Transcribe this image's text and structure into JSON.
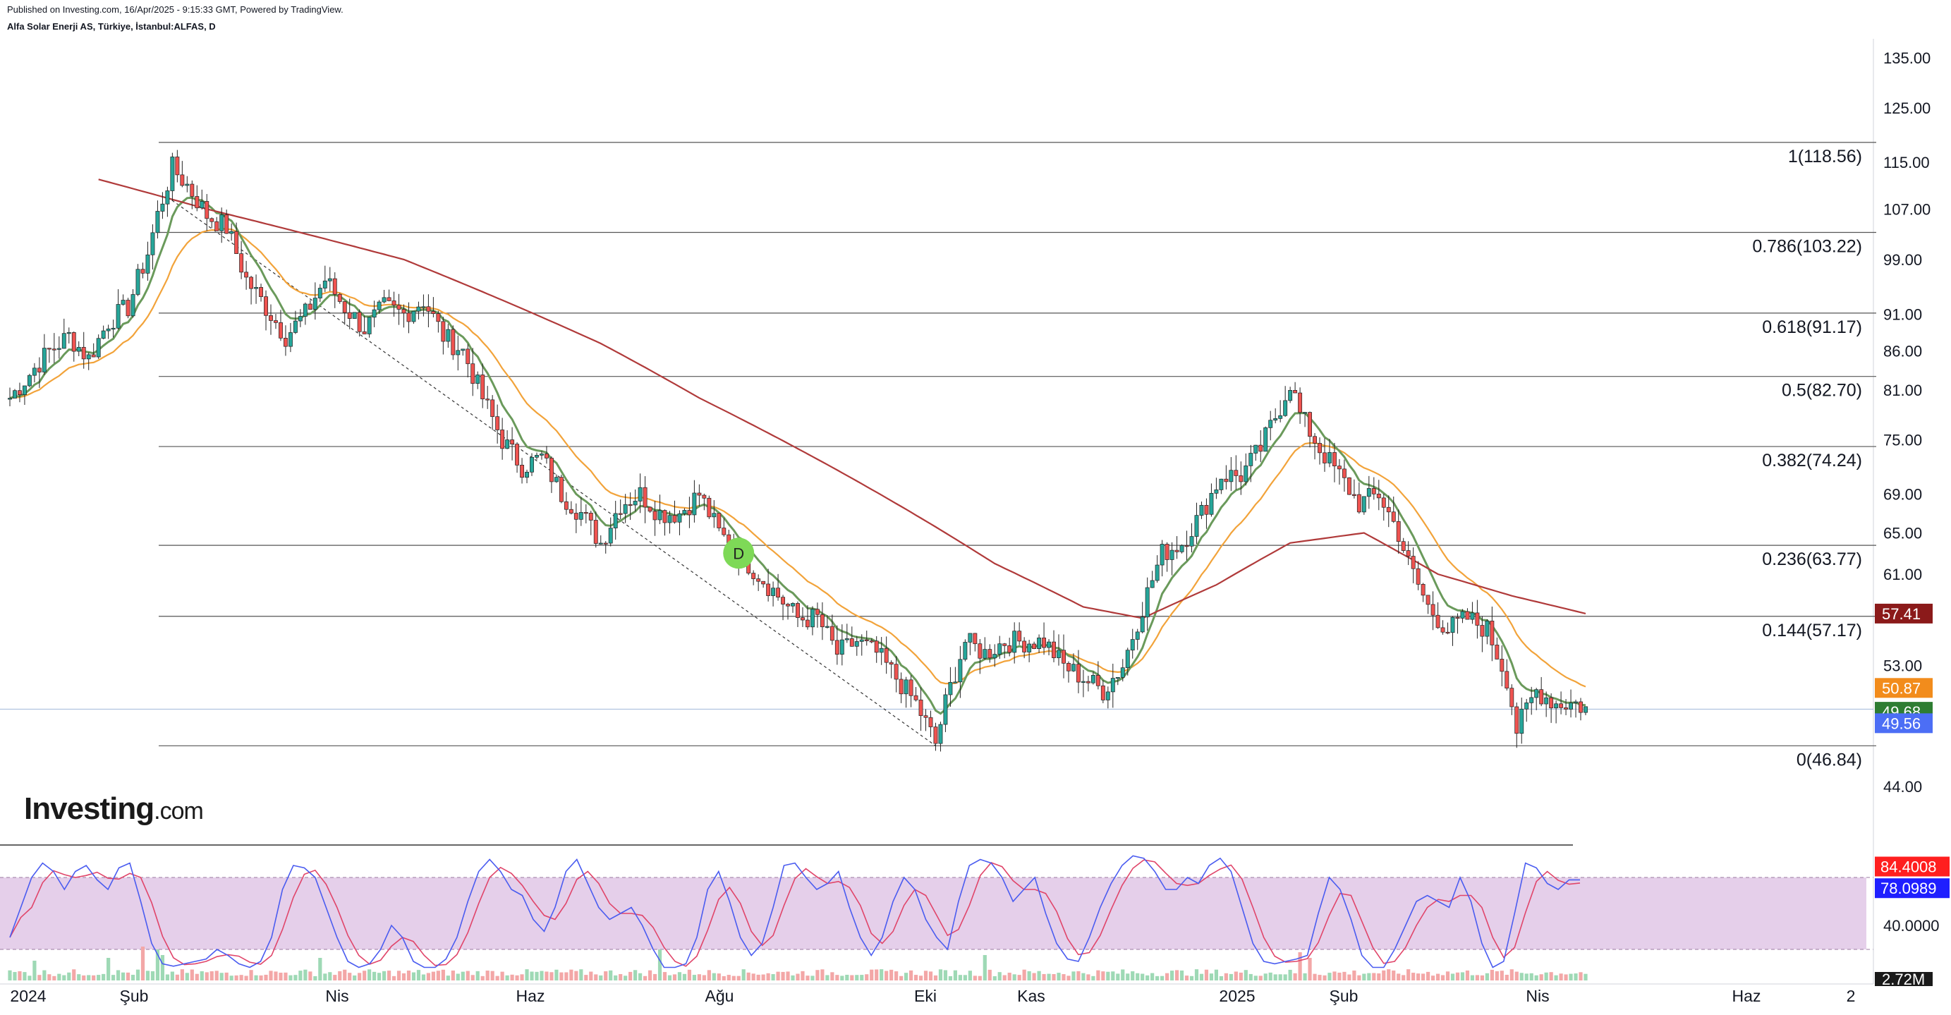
{
  "header": {
    "published": "Published on Investing.com, 16/Apr/2025 - 9:15:33 GMT, Powered by TradingView.",
    "symbol": "Alfa Solar Enerji AS, Türkiye, İstanbul:ALFAS, D"
  },
  "logo": {
    "brand": "Investing",
    "domain": ".com"
  },
  "colors": {
    "bull": "#26a69a",
    "bear": "#ef5350",
    "ema_fast": "#6a9a5b",
    "ema_mid": "#f2a33a",
    "ema_slow": "#b03a3a",
    "fib_line": "#555555",
    "stoch_k": "#4a5cf0",
    "stoch_d": "#e0456a",
    "stoch_band": "#e1c7e6"
  },
  "chart_data": [
    {
      "type": "candlestick",
      "title": "Alfa Solar Enerji AS, Türkiye, İstanbul:ALFAS, D",
      "x_ticks": [
        "2024",
        "Şub",
        "Nis",
        "Haz",
        "Ağu",
        "Eki",
        "Kas",
        "2025",
        "Şub",
        "Nis",
        "Haz",
        "2"
      ],
      "y_ticks": [
        135.0,
        125.0,
        115.0,
        107.0,
        99.0,
        91.0,
        86.0,
        81.0,
        75.0,
        69.0,
        65.0,
        61.0,
        53.0,
        44.0
      ],
      "y_tick_labels": [
        "135.00",
        "125.00",
        "115.00",
        "107.00",
        "99.00",
        "91.00",
        "86.00",
        "81.00",
        "75.00",
        "69.00",
        "65.00",
        "61.00",
        "53.00",
        "44.00"
      ],
      "ylim": [
        41,
        138
      ],
      "fib_levels": [
        {
          "label": "1(118.56)",
          "value": 118.56
        },
        {
          "label": "0.786(103.22)",
          "value": 103.22
        },
        {
          "label": "0.618(91.17)",
          "value": 91.17
        },
        {
          "label": "0.5(82.70)",
          "value": 82.7
        },
        {
          "label": "0.382(74.24)",
          "value": 74.24
        },
        {
          "label": "0.236(63.77)",
          "value": 63.77
        },
        {
          "label": "0.144(57.17)",
          "value": 57.17
        },
        {
          "label": "0(46.84)",
          "value": 46.84
        }
      ],
      "badges": [
        {
          "text": "57.41",
          "value": 57.41,
          "color": "#8b1a1a"
        },
        {
          "text": "50.87",
          "value": 50.87,
          "color": "#f28c1c"
        },
        {
          "text": "49.68",
          "value": 49.68,
          "color": "#2e7d32"
        },
        {
          "text": "49.56",
          "value": 49.56,
          "color": "#4c6ef5"
        }
      ],
      "marker": {
        "text": "D",
        "date_index": 148,
        "value": 63.0
      },
      "price_anchors": [
        [
          0,
          80
        ],
        [
          4,
          83
        ],
        [
          8,
          86
        ],
        [
          12,
          88
        ],
        [
          16,
          85
        ],
        [
          20,
          90
        ],
        [
          24,
          92
        ],
        [
          28,
          100
        ],
        [
          30,
          106
        ],
        [
          33,
          114
        ],
        [
          36,
          111
        ],
        [
          40,
          106
        ],
        [
          44,
          104
        ],
        [
          48,
          96
        ],
        [
          52,
          92
        ],
        [
          56,
          88
        ],
        [
          60,
          91
        ],
        [
          64,
          96
        ],
        [
          68,
          92
        ],
        [
          72,
          89
        ],
        [
          76,
          92
        ],
        [
          80,
          91
        ],
        [
          84,
          93
        ],
        [
          88,
          88
        ],
        [
          92,
          86
        ],
        [
          96,
          80
        ],
        [
          100,
          75
        ],
        [
          104,
          72
        ],
        [
          108,
          73
        ],
        [
          112,
          69
        ],
        [
          116,
          67
        ],
        [
          120,
          64
        ],
        [
          124,
          68
        ],
        [
          128,
          69
        ],
        [
          132,
          67
        ],
        [
          136,
          67
        ],
        [
          140,
          69
        ],
        [
          144,
          65
        ],
        [
          148,
          63
        ],
        [
          152,
          61
        ],
        [
          156,
          59
        ],
        [
          160,
          57
        ],
        [
          164,
          57
        ],
        [
          168,
          54
        ],
        [
          172,
          55
        ],
        [
          176,
          54
        ],
        [
          180,
          52
        ],
        [
          184,
          50
        ],
        [
          188,
          47
        ],
        [
          190,
          50
        ],
        [
          194,
          55
        ],
        [
          198,
          54
        ],
        [
          202,
          55
        ],
        [
          206,
          55
        ],
        [
          210,
          55
        ],
        [
          214,
          53
        ],
        [
          218,
          52
        ],
        [
          222,
          51
        ],
        [
          226,
          53
        ],
        [
          230,
          58
        ],
        [
          234,
          63
        ],
        [
          238,
          64
        ],
        [
          242,
          67
        ],
        [
          246,
          71
        ],
        [
          250,
          71
        ],
        [
          254,
          74
        ],
        [
          258,
          79
        ],
        [
          260,
          82
        ],
        [
          262,
          78
        ],
        [
          266,
          74
        ],
        [
          270,
          71
        ],
        [
          274,
          68
        ],
        [
          278,
          69
        ],
        [
          282,
          65
        ],
        [
          284,
          62
        ],
        [
          288,
          58
        ],
        [
          292,
          56
        ],
        [
          296,
          57
        ],
        [
          300,
          56
        ],
        [
          304,
          52
        ],
        [
          306,
          48
        ],
        [
          310,
          51
        ],
        [
          314,
          50
        ],
        [
          318,
          50
        ],
        [
          320,
          49.6
        ]
      ],
      "ema_slow_anchors": [
        [
          18,
          112
        ],
        [
          40,
          107
        ],
        [
          60,
          103
        ],
        [
          80,
          99
        ],
        [
          100,
          93
        ],
        [
          120,
          87
        ],
        [
          140,
          80
        ],
        [
          160,
          74
        ],
        [
          180,
          68
        ],
        [
          200,
          62
        ],
        [
          218,
          58
        ],
        [
          230,
          57
        ],
        [
          245,
          60
        ],
        [
          260,
          64
        ],
        [
          275,
          65
        ],
        [
          290,
          61
        ],
        [
          305,
          59
        ],
        [
          320,
          57.41
        ]
      ],
      "volume_spikes": [
        [
          5,
          0.4
        ],
        [
          20,
          0.5
        ],
        [
          27,
          0.9
        ],
        [
          30,
          0.8
        ],
        [
          31,
          0.6
        ],
        [
          63,
          0.5
        ],
        [
          132,
          0.8
        ],
        [
          198,
          0.6
        ],
        [
          262,
          0.7
        ],
        [
          264,
          0.5
        ]
      ],
      "series": [
        {
          "name": "",
          "values": []
        }
      ]
    },
    {
      "type": "line",
      "title": "",
      "y_ticks": [
        40.0
      ],
      "y_tick_labels": [
        "40.0000"
      ],
      "band": [
        20,
        80
      ],
      "ylim": [
        0,
        100
      ],
      "badges": [
        {
          "text": "84.4008",
          "value": 84.4008,
          "color": "#ff1f1f"
        },
        {
          "text": "78.0989",
          "value": 78.0989,
          "color": "#1f1fff"
        }
      ],
      "volume_badge": {
        "text": "2.72M"
      },
      "series": [
        {
          "name": "",
          "values": [
            30,
            55,
            80,
            92,
            85,
            70,
            85,
            90,
            78,
            70,
            88,
            92,
            60,
            25,
            8,
            6,
            8,
            10,
            12,
            20,
            15,
            8,
            5,
            10,
            30,
            70,
            90,
            88,
            80,
            55,
            30,
            10,
            5,
            8,
            20,
            40,
            30,
            10,
            5,
            5,
            12,
            30,
            60,
            85,
            95,
            85,
            70,
            65,
            45,
            35,
            55,
            85,
            95,
            75,
            55,
            45,
            50,
            55,
            40,
            20,
            5,
            5,
            8,
            30,
            70,
            85,
            60,
            30,
            15,
            25,
            55,
            90,
            92,
            80,
            70,
            75,
            85,
            55,
            30,
            15,
            30,
            60,
            80,
            70,
            45,
            30,
            20,
            60,
            90,
            95,
            92,
            80,
            60,
            70,
            80,
            50,
            25,
            12,
            10,
            30,
            55,
            75,
            90,
            98,
            96,
            85,
            70,
            70,
            80,
            75,
            90,
            96,
            85,
            55,
            25,
            10,
            8,
            10,
            12,
            15,
            50,
            80,
            70,
            45,
            15,
            5,
            5,
            20,
            40,
            60,
            65,
            60,
            55,
            80,
            60,
            25,
            5,
            10,
            50,
            92,
            88,
            75,
            70,
            78,
            78
          ]
        }
      ]
    }
  ]
}
